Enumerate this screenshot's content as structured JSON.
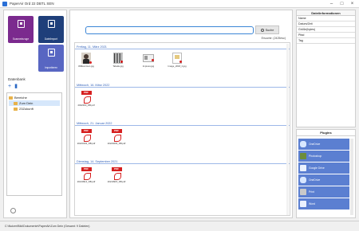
{
  "window": {
    "title": "PaperAir Ord 22 DBTL SEN"
  },
  "tiles": [
    {
      "label": "Scanneinzuge",
      "color": "#7b2a8e",
      "icon": "scanner-icon"
    },
    {
      "label": "Dateiimport",
      "color": "#1f3f7a",
      "icon": "file-import-icon"
    },
    {
      "label": "Importieren",
      "color": "#5866c2",
      "icon": "import-icon"
    }
  ],
  "database": {
    "heading": "Datenbank",
    "add_label": "+",
    "tree": [
      {
        "label": "Bereiche",
        "level": 0,
        "selected": false
      },
      {
        "label": "Zum Dein",
        "level": 1,
        "selected": true
      },
      {
        "label": "23Zukunft",
        "level": 1,
        "selected": false
      }
    ]
  },
  "search": {
    "value": "",
    "button_label": "Suche",
    "result_text": "Ersuche: (2425esc)"
  },
  "groups": [
    {
      "header": "Freitag, 11. März 2021",
      "items": [
        {
          "name": "Willkommen.jpg",
          "kind": "photo"
        },
        {
          "name": "Tabelle.jpg",
          "kind": "barcode"
        },
        {
          "name": "Impress.jpg",
          "kind": "card"
        },
        {
          "name": "Image_2018_Ii.jpg",
          "kind": "doc"
        }
      ]
    },
    {
      "header": "Mittwoch, 16. März 2022",
      "items": [
        {
          "name": "2022003_DB.pdf",
          "kind": "pdf"
        }
      ]
    },
    {
      "header": "Mittwoch, 21. Januar 2022",
      "items": [
        {
          "name": "20220102_DB.pdf",
          "kind": "pdf"
        },
        {
          "name": "20220203_DB.pdf",
          "kind": "pdf"
        }
      ]
    },
    {
      "header": "Dienstag, 14. September 2021",
      "items": [
        {
          "name": "20210914_DB.pdf",
          "kind": "pdf"
        },
        {
          "name": "20210915_DB.pdf",
          "kind": "pdf"
        }
      ]
    }
  ],
  "metadata": {
    "heading": "Dateiinformationen",
    "rows": [
      "Name",
      "Datum/Zeit",
      "Größe(bytes)",
      "Pfad",
      "Tag"
    ]
  },
  "plugins": {
    "heading": "Plugins",
    "items": [
      {
        "label": "OneDrive",
        "icon": "cloud-icon"
      },
      {
        "label": "Photoshop",
        "icon": "palette-icon"
      },
      {
        "label": "Google Drive",
        "icon": "google-drive-icon"
      },
      {
        "label": "OneDrive",
        "icon": "cloud-icon"
      },
      {
        "label": "Print",
        "icon": "printer-icon"
      },
      {
        "label": "Word",
        "icon": "word-icon"
      }
    ]
  },
  "statusbar": {
    "text": "C:\\Nutzer\\Bild\\Dokumente\\PaperAir\\Zum Dein (Gesamt: 9 Dateien)"
  }
}
